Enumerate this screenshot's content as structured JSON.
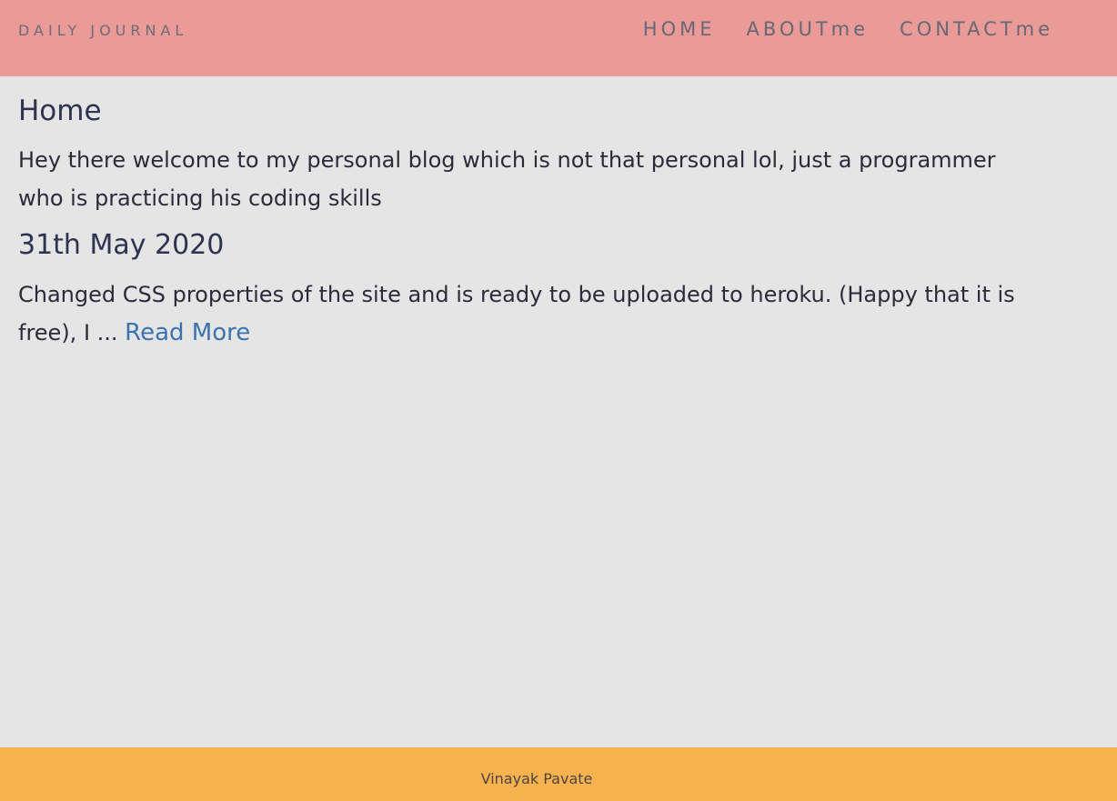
{
  "nav": {
    "brand": "DAILY JOURNAL",
    "links": [
      {
        "label": "HOME"
      },
      {
        "label": "ABOUTme"
      },
      {
        "label": "CONTACTme"
      }
    ]
  },
  "main": {
    "title": "Home",
    "intro": "Hey there welcome to my personal blog which is not that personal lol, just a programmer who is practicing his coding skills",
    "posts": [
      {
        "title": "31th May 2020",
        "excerpt": "Changed CSS properties of the site and is ready to be uploaded to heroku. (Happy that it is free), I ...",
        "read_more": "Read More"
      }
    ]
  },
  "footer": {
    "text": "Vinayak Pavate"
  },
  "colors": {
    "navbar_bg": "#EA9A97",
    "page_bg": "#E5E5E5",
    "footer_bg": "#F8B250",
    "link": "#3A73B0"
  }
}
